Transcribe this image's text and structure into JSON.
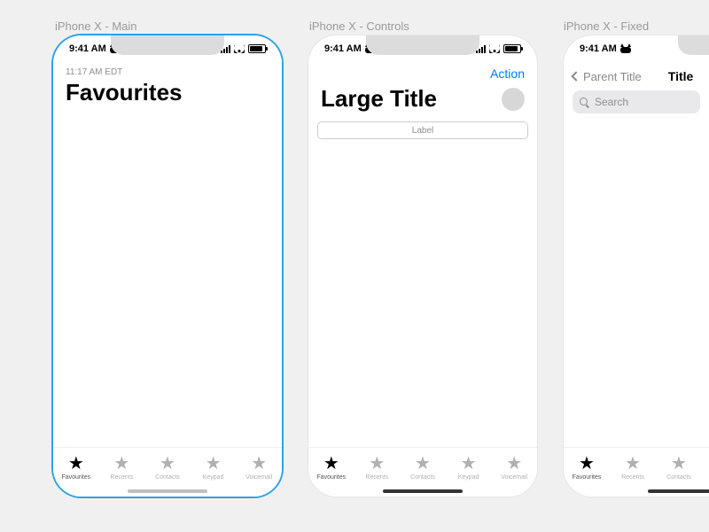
{
  "captions": {
    "main": "iPhone X - Main",
    "controls": "iPhone X - Controls",
    "fixed": "iPhone X - Fixed"
  },
  "status": {
    "time": "9:41 AM"
  },
  "screen1": {
    "timestamp": "11:17 AM EDT",
    "title": "Favourites"
  },
  "screen2": {
    "action": "Action",
    "title": "Large Title",
    "segment_label": "Label"
  },
  "screen3": {
    "parent": "Parent Title",
    "title": "Title",
    "search_placeholder": "Search"
  },
  "tabs": [
    {
      "label": "Favourites",
      "active": true
    },
    {
      "label": "Recents",
      "active": false
    },
    {
      "label": "Contacts",
      "active": false
    },
    {
      "label": "Keypad",
      "active": false
    },
    {
      "label": "Voicemail",
      "active": false
    }
  ],
  "tabs3": [
    {
      "label": "Favourites",
      "active": true
    },
    {
      "label": "Recents",
      "active": false
    },
    {
      "label": "Contacts",
      "active": false
    }
  ]
}
